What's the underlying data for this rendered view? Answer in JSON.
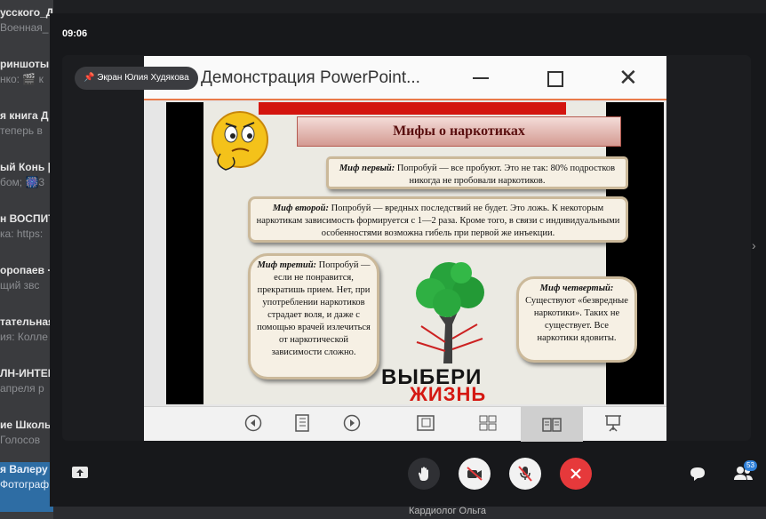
{
  "background_chats": [
    {
      "title": "усского_Д",
      "sub": "Военная_"
    },
    {
      "title": "риншоты",
      "sub": "нко: 🎬 к"
    },
    {
      "title": "я книга Д",
      "sub": "теперь в"
    },
    {
      "title": "ый Конь |",
      "sub": "бом; 🎆3"
    },
    {
      "title": "н ВОСПИТ",
      "sub": "ка: https:"
    },
    {
      "title": "оропаев ·",
      "sub": "щий звс"
    },
    {
      "title": "тательная",
      "sub": "ия: Колле"
    },
    {
      "title": "ЛН-ИНТЕН",
      "sub": "апреля р"
    },
    {
      "title": "ие Школь",
      "sub": "Голосов"
    },
    {
      "title": "я Валеру",
      "sub": "Фотограф"
    }
  ],
  "bottom_hint": "Кардиолог Ольга",
  "call": {
    "time": "09:06",
    "presenter_label": "Экран Юлия Худякова",
    "participants_count": "53"
  },
  "shared_window": {
    "title": "Демонстрация PowerPoint...",
    "slide": {
      "heading": "Мифы о наркотиках",
      "myth1_label": "Миф первый:",
      "myth1_text": " Попробуй — все пробуют. Это не так: 80% подростков никогда не пробовали наркотиков.",
      "myth2_label": "Миф второй:",
      "myth2_text": " Попробуй — вредных последствий не будет. Это ложь. К некоторым наркотикам зависимость формируется с 1—2 раза. Кроме того, в связи с индивидуальными особенностями возможна гибель при первой же инъекции.",
      "myth3_label": "Миф третий:",
      "myth3_text": " Попробуй — если не понравится, прекратишь прием. Нет, при употреблении наркотиков страдает воля, и даже с помощью врачей излечиться от наркотической зависимости сложно.",
      "myth4_label": "Миф четвертый:",
      "myth4_text": " Существуют «безвредные наркотики». Таких не существует. Все наркотики ядовиты.",
      "slogan_top": "ВЫБЕРИ",
      "slogan_bottom": "ЖИЗНЬ"
    }
  },
  "colors": {
    "accent": "#e97a4a",
    "end_call": "#e6393b",
    "banner_red": "#d3150f",
    "badge": "#2f80d9"
  }
}
